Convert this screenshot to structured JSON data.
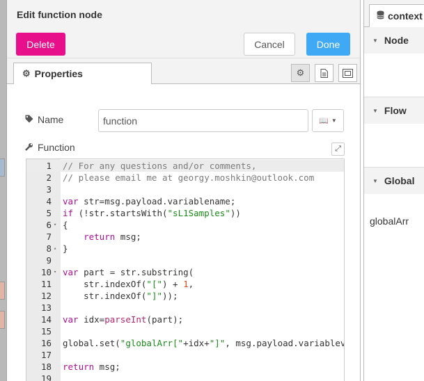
{
  "tray": {
    "title": "Edit function node",
    "buttons": {
      "delete": "Delete",
      "cancel": "Cancel",
      "done": "Done"
    },
    "tabs": {
      "properties": "Properties"
    },
    "icons": {
      "settings": "gear-icon",
      "description": "document-icon",
      "appearance": "frame-icon"
    }
  },
  "form": {
    "name_label": "Name",
    "name_value": "function",
    "function_label": "Function"
  },
  "editor": {
    "lines": [
      {
        "n": "1",
        "fold": "",
        "html": "<span class=\"cm\">// For any questions and/or comments,</span>"
      },
      {
        "n": "2",
        "fold": "",
        "html": "<span class=\"cm\">// please email me at georgy.moshkin@outlook.com</span>"
      },
      {
        "n": "3",
        "fold": "",
        "html": ""
      },
      {
        "n": "4",
        "fold": "",
        "html": "<span class=\"kw\">var</span> str=msg.payload.variablename;"
      },
      {
        "n": "5",
        "fold": "",
        "html": "<span class=\"kw\">if</span> (!str.startsWith(<span class=\"str\">\"sL1Samples\"</span>))"
      },
      {
        "n": "6",
        "fold": "▾",
        "html": "{"
      },
      {
        "n": "7",
        "fold": "",
        "html": "    <span class=\"kw\">return</span> msg;"
      },
      {
        "n": "8",
        "fold": "▴",
        "html": "}"
      },
      {
        "n": "9",
        "fold": "",
        "html": ""
      },
      {
        "n": "10",
        "fold": "▾",
        "html": "<span class=\"kw\">var</span> part = str.substring("
      },
      {
        "n": "11",
        "fold": "",
        "html": "    str.indexOf(<span class=\"str\">\"[\"</span>) + <span class=\"num\">1</span>,"
      },
      {
        "n": "12",
        "fold": "",
        "html": "    str.indexOf(<span class=\"str\">\"]\"</span>));"
      },
      {
        "n": "13",
        "fold": "",
        "html": ""
      },
      {
        "n": "14",
        "fold": "",
        "html": "<span class=\"kw\">var</span> idx=<span class=\"fn\">parseInt</span>(part);"
      },
      {
        "n": "15",
        "fold": "",
        "html": ""
      },
      {
        "n": "16",
        "fold": "",
        "html": "global.set(<span class=\"str\">\"globalArr[\"</span>+idx+<span class=\"str\">\"]\"</span>, msg.payload.variablevalue);"
      },
      {
        "n": "17",
        "fold": "",
        "html": ""
      },
      {
        "n": "18",
        "fold": "",
        "html": "<span class=\"kw\">return</span> msg;"
      },
      {
        "n": "19",
        "fold": "",
        "html": ""
      }
    ]
  },
  "sidebar": {
    "tab_label": "context",
    "sections": [
      {
        "label": "Node"
      },
      {
        "label": "Flow"
      },
      {
        "label": "Global"
      }
    ],
    "global_item": "globalArr"
  },
  "colors": {
    "delete": "#e8108a",
    "done": "#3fa9f5",
    "panel_bg": "#f3f3f3"
  }
}
